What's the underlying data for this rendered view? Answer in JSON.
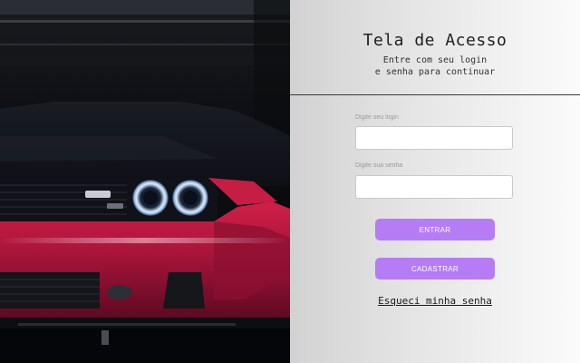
{
  "header": {
    "title": "Tela de Acesso",
    "subtitle_line1": "Entre com seu login",
    "subtitle_line2": "e senha para continuar"
  },
  "form": {
    "login_label": "Digite seu login",
    "login_value": "",
    "password_label": "Digite sua senha",
    "password_value": "",
    "enter_button": "ENTRAR",
    "register_button": "CADASTRAR",
    "forgot_link": "Esqueci minha senha"
  },
  "colors": {
    "button": "#b57cf6",
    "car_body": "#b3173a",
    "headlight_ring": "#e8f3ff"
  },
  "hero_image": "red muscle car front view"
}
